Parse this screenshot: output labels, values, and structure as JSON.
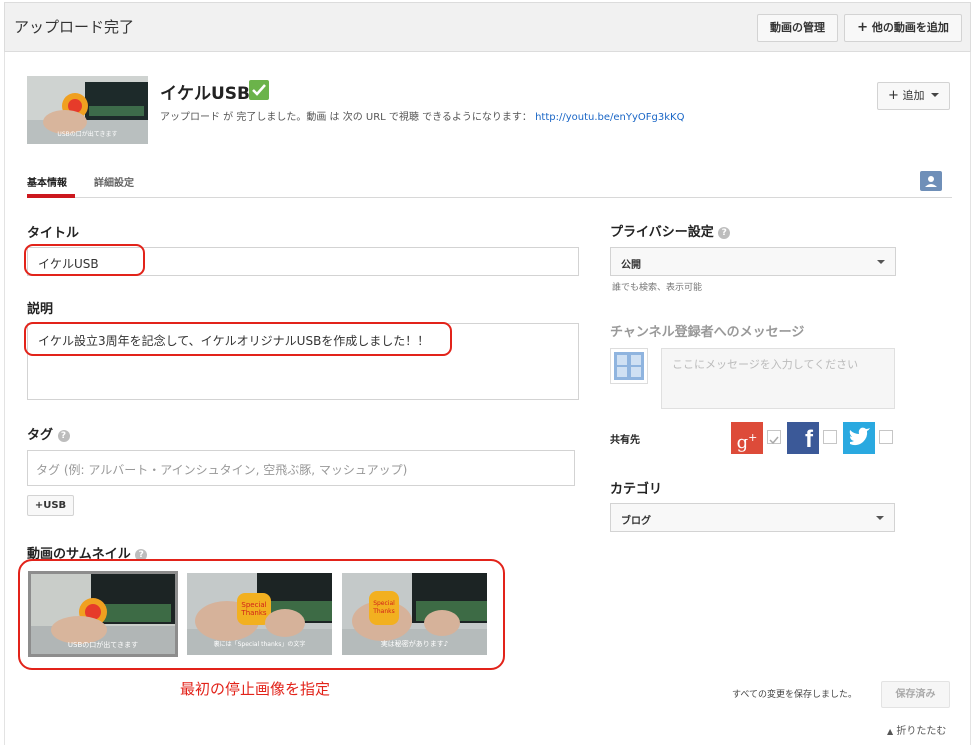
{
  "header": {
    "title": "アップロード完了",
    "manage_button": "動画の管理",
    "add_more_button": "他の動画を追加",
    "add_more_icon": "plus-icon"
  },
  "video": {
    "title": "イケルUSB",
    "upload_message": "アップロード が 完了しました。動画 は 次の URL で視聴 できるようになります：",
    "url": "http://youtu.be/enYyOFg3kKQ",
    "thumbnail_caption": "USBの口が出てきます",
    "add_button": "追加"
  },
  "tabs": [
    {
      "label": "基本情報",
      "active": true
    },
    {
      "label": "詳細設定",
      "active": false
    }
  ],
  "form": {
    "title_label": "タイトル",
    "title_value": "イケルUSB",
    "description_label": "説明",
    "description_value": "イケル設立3周年を記念して、イケルオリジナルUSBを作成しました！！",
    "tags_label": "タグ",
    "tags_placeholder": "タグ (例: アルバート・アインシュタイン, 空飛ぶ豚, マッシュアップ)",
    "tag_chip": "+USB",
    "thumbnail_label": "動画のサムネイル",
    "thumbnails": [
      {
        "caption": "USBの口が出てきます",
        "selected": true
      },
      {
        "caption": "裏には「Special thanks」の文字",
        "selected": false
      },
      {
        "caption": "実は秘密があります♪",
        "selected": false
      }
    ],
    "annotation": "最初の停止画像を指定"
  },
  "sidebar": {
    "privacy_label": "プライバシー設定",
    "privacy_value": "公開",
    "privacy_hint": "誰でも検索、表示可能",
    "message_label": "チャンネル登録者へのメッセージ",
    "message_placeholder": "ここにメッセージを入力してください",
    "share_label": "共有先",
    "category_label": "カテゴリ",
    "category_value": "ブログ"
  },
  "footer": {
    "save_status": "すべての変更を保存しました。",
    "save_button": "保存済み",
    "collapse_link": "折りたたむ"
  },
  "colors": {
    "accent_red": "#cc181e",
    "annotation_red": "#e2231a",
    "link_blue": "#1a66c6",
    "google_red": "#dd4b39",
    "facebook_blue": "#3b5998",
    "twitter_blue": "#2aa9e0",
    "check_green": "#6bb34a"
  }
}
